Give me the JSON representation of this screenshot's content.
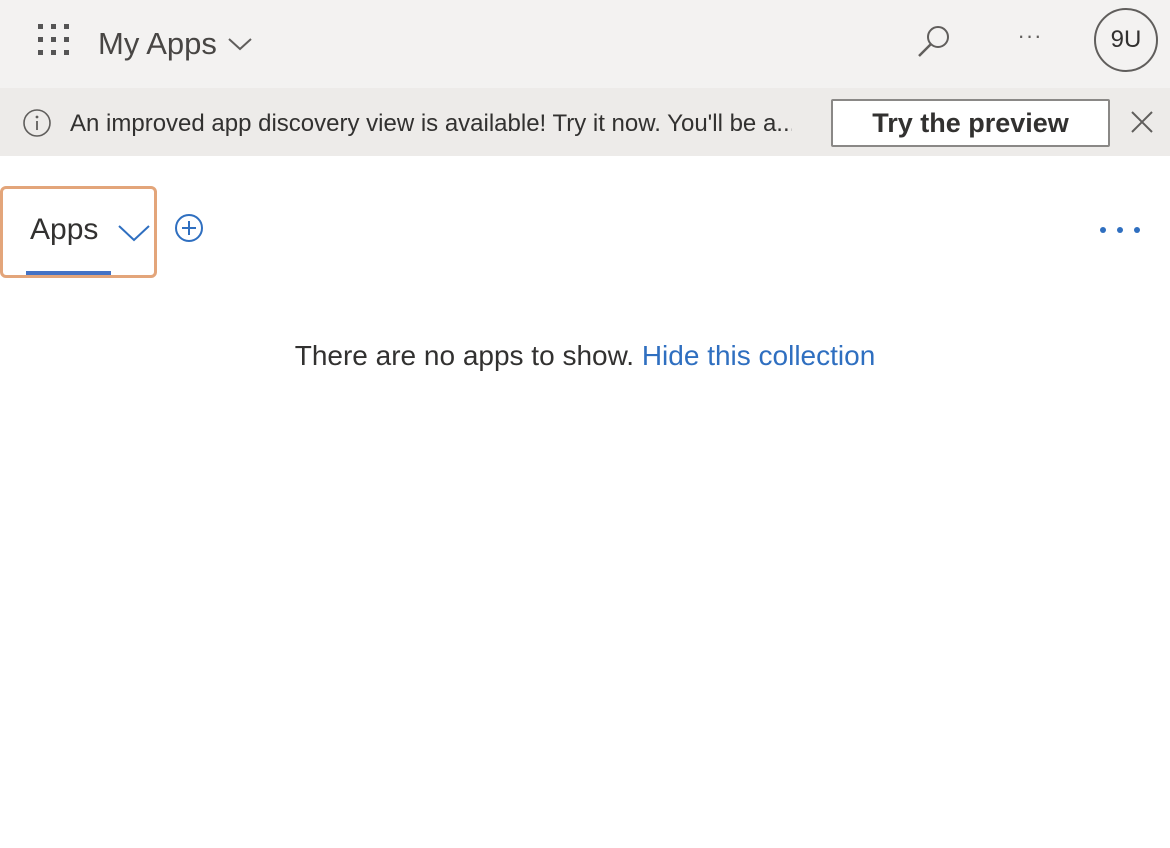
{
  "header": {
    "app_title": "My Apps",
    "avatar_initials": "9U",
    "more_label": "···"
  },
  "banner": {
    "message": "An improved app discovery view is available! Try it now. You'll be a...",
    "preview_button": "Try the preview"
  },
  "collection": {
    "tab_label": "Apps",
    "empty_message": "There are no apps to show.",
    "hide_link": "Hide this collection"
  },
  "colors": {
    "accent": "#2f6fc0",
    "tab_underline": "#4472c4",
    "focus_outline": "#e3a57a",
    "topbar_bg": "#f3f2f1",
    "banner_bg": "#edebe9"
  },
  "icons": [
    "waffle-icon",
    "chevron-down-icon",
    "search-icon",
    "more-icon",
    "info-icon",
    "close-icon",
    "add-icon",
    "ellipsis-icon"
  ]
}
